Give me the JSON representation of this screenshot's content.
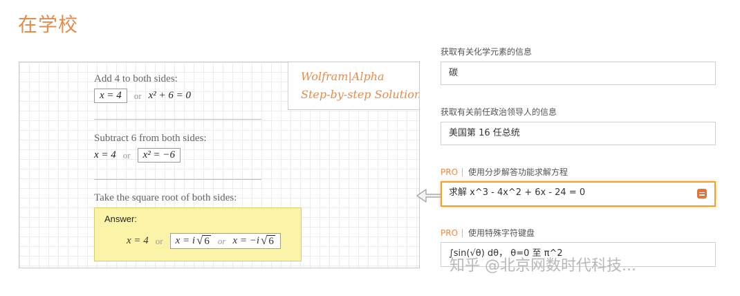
{
  "section_title": "在学校",
  "brand": {
    "line1": "Wolfram|Alpha",
    "line2": "Step-by-step Solution"
  },
  "steps": {
    "step1_text": "Add 4 to both sides:",
    "step1_left": "x = 4",
    "step1_or": "or",
    "step1_right": "x² + 6 = 0",
    "step2_text": "Subtract 6 from both sides:",
    "step2_left": "x = 4",
    "step2_or": "or",
    "step2_right": "x² = −6",
    "step3_text": "Take the square root of both sides:"
  },
  "answer": {
    "label": "Answer:",
    "left": "x = 4",
    "or1": "or",
    "root1_prefix": "x = i",
    "root_radicand": "6",
    "or2": "or",
    "root2_prefix": "x = −i"
  },
  "examples": [
    {
      "label": "获取有关化学元素的信息",
      "value": "碳",
      "pro": ""
    },
    {
      "label": "获取有关前任政治领导人的信息",
      "value": "美国第 16 任总统",
      "pro": ""
    },
    {
      "label": "使用分步解答功能求解方程",
      "value": "求解 x^3 - 4x^2 + 6x - 24 = 0",
      "pro": "PRO"
    },
    {
      "label": "使用特殊字符键盘",
      "value": "∫sin(√θ) dθ， θ=0 至 π^2",
      "pro": "PRO"
    }
  ],
  "watermark": "知乎 @北京网数时代科技...",
  "colors": {
    "accent": "#e48c4a",
    "active_border": "#f0a12a",
    "answer_bg": "#fbf4a8"
  }
}
